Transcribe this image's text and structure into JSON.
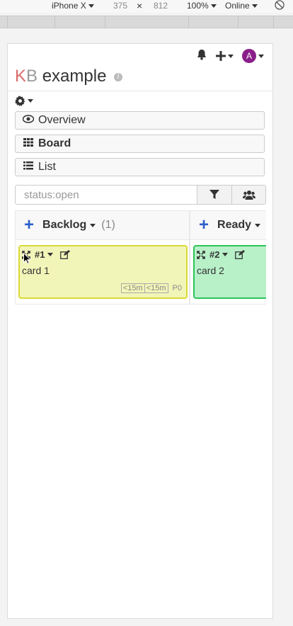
{
  "devtools": {
    "device": "iPhone X",
    "width": "375",
    "sep": "×",
    "height": "812",
    "zoom": "100%",
    "network": "Online"
  },
  "header": {
    "avatar_letter": "A",
    "title_k": "K",
    "title_b": "B",
    "title_rest": " example",
    "info": "i"
  },
  "nav": {
    "overview": "Overview",
    "board": "Board",
    "list": "List"
  },
  "search": {
    "value": "status:open"
  },
  "columns": [
    {
      "name": "Backlog",
      "count": "(1)",
      "card": {
        "id": "#1",
        "title": "card 1",
        "time1": "<15m",
        "time2": "<15m",
        "priority": "P0",
        "color": "#f2f5b8"
      }
    },
    {
      "name": "Ready",
      "count": "",
      "card": {
        "id": "#2",
        "title": "card 2",
        "color": "#b8f0c8"
      }
    }
  ],
  "colors": {
    "accent_plus": "#2c5fc9",
    "avatar": "#8a1f8a"
  }
}
